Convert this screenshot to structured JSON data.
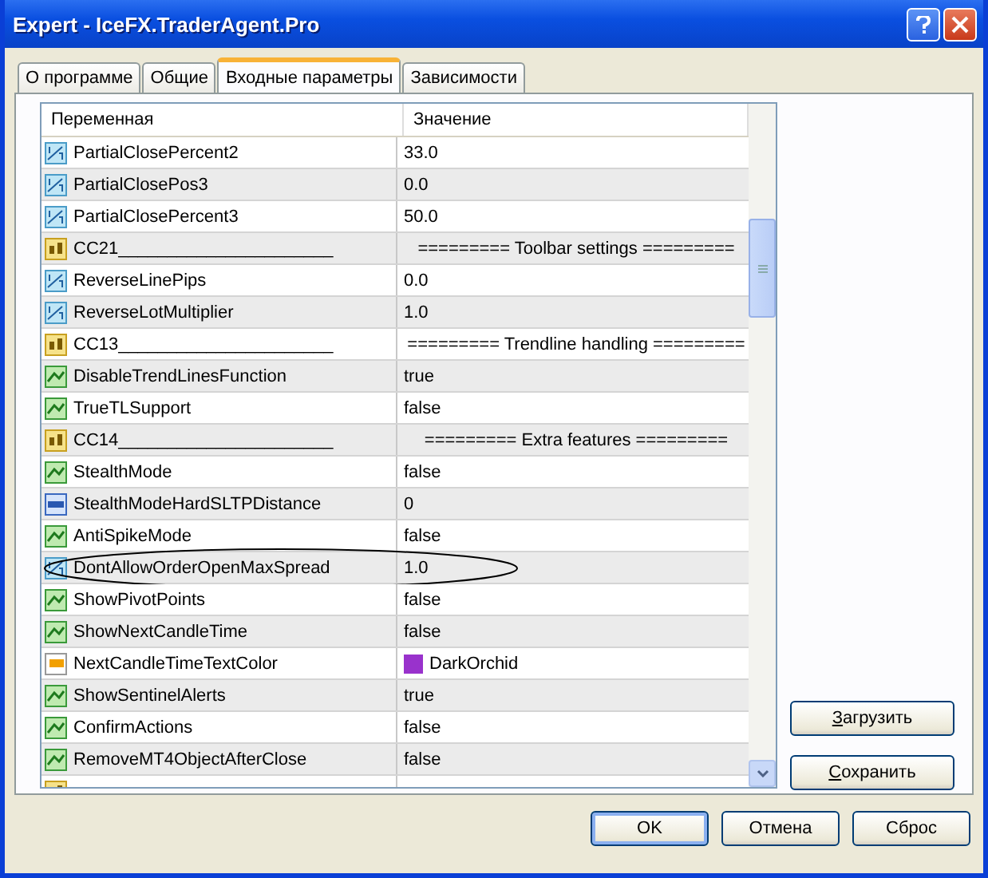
{
  "window": {
    "title": "Expert - IceFX.TraderAgent.Pro"
  },
  "tabs": [
    {
      "label": "О программе",
      "selected": false
    },
    {
      "label": "Общие",
      "selected": false
    },
    {
      "label": "Входные параметры",
      "selected": true
    },
    {
      "label": "Зависимости",
      "selected": false
    }
  ],
  "table": {
    "columns": [
      "Переменная",
      "Значение"
    ],
    "rows": [
      {
        "kind": "double",
        "name": "PartialClosePercent2",
        "value": "33.0"
      },
      {
        "kind": "double",
        "name": "PartialClosePos3",
        "value": "0.0"
      },
      {
        "kind": "double",
        "name": "PartialClosePercent3",
        "value": "50.0"
      },
      {
        "kind": "string",
        "name": "CC21______________________",
        "value": "========= Toolbar settings ========="
      },
      {
        "kind": "double",
        "name": "ReverseLinePips",
        "value": "0.0"
      },
      {
        "kind": "double",
        "name": "ReverseLotMultiplier",
        "value": "1.0"
      },
      {
        "kind": "string",
        "name": "CC13______________________",
        "value": "========= Trendline handling ========="
      },
      {
        "kind": "bool",
        "name": "DisableTrendLinesFunction",
        "value": "true"
      },
      {
        "kind": "bool",
        "name": "TrueTLSupport",
        "value": "false"
      },
      {
        "kind": "string",
        "name": "CC14______________________",
        "value": "========= Extra features ========="
      },
      {
        "kind": "bool",
        "name": "StealthMode",
        "value": "false"
      },
      {
        "kind": "int",
        "name": "StealthModeHardSLTPDistance",
        "value": "0"
      },
      {
        "kind": "bool",
        "name": "AntiSpikeMode",
        "value": "false"
      },
      {
        "kind": "double",
        "name": "DontAllowOrderOpenMaxSpread",
        "value": "1.0",
        "circled": true
      },
      {
        "kind": "bool",
        "name": "ShowPivotPoints",
        "value": "false"
      },
      {
        "kind": "bool",
        "name": "ShowNextCandleTime",
        "value": "false"
      },
      {
        "kind": "color",
        "name": "NextCandleTimeTextColor",
        "value": "DarkOrchid",
        "color": "#9932cc"
      },
      {
        "kind": "bool",
        "name": "ShowSentinelAlerts",
        "value": "true"
      },
      {
        "kind": "bool",
        "name": "ConfirmActions",
        "value": "false"
      },
      {
        "kind": "bool",
        "name": "RemoveMT4ObjectAfterClose",
        "value": "false"
      },
      {
        "kind": "string",
        "name": "",
        "value": ""
      }
    ]
  },
  "side_buttons": [
    "Загрузить",
    "Сохранить"
  ],
  "buttons": [
    {
      "label": "OK",
      "default": true
    },
    {
      "label": "Отмена",
      "default": false
    },
    {
      "label": "Сброс",
      "default": false
    }
  ]
}
